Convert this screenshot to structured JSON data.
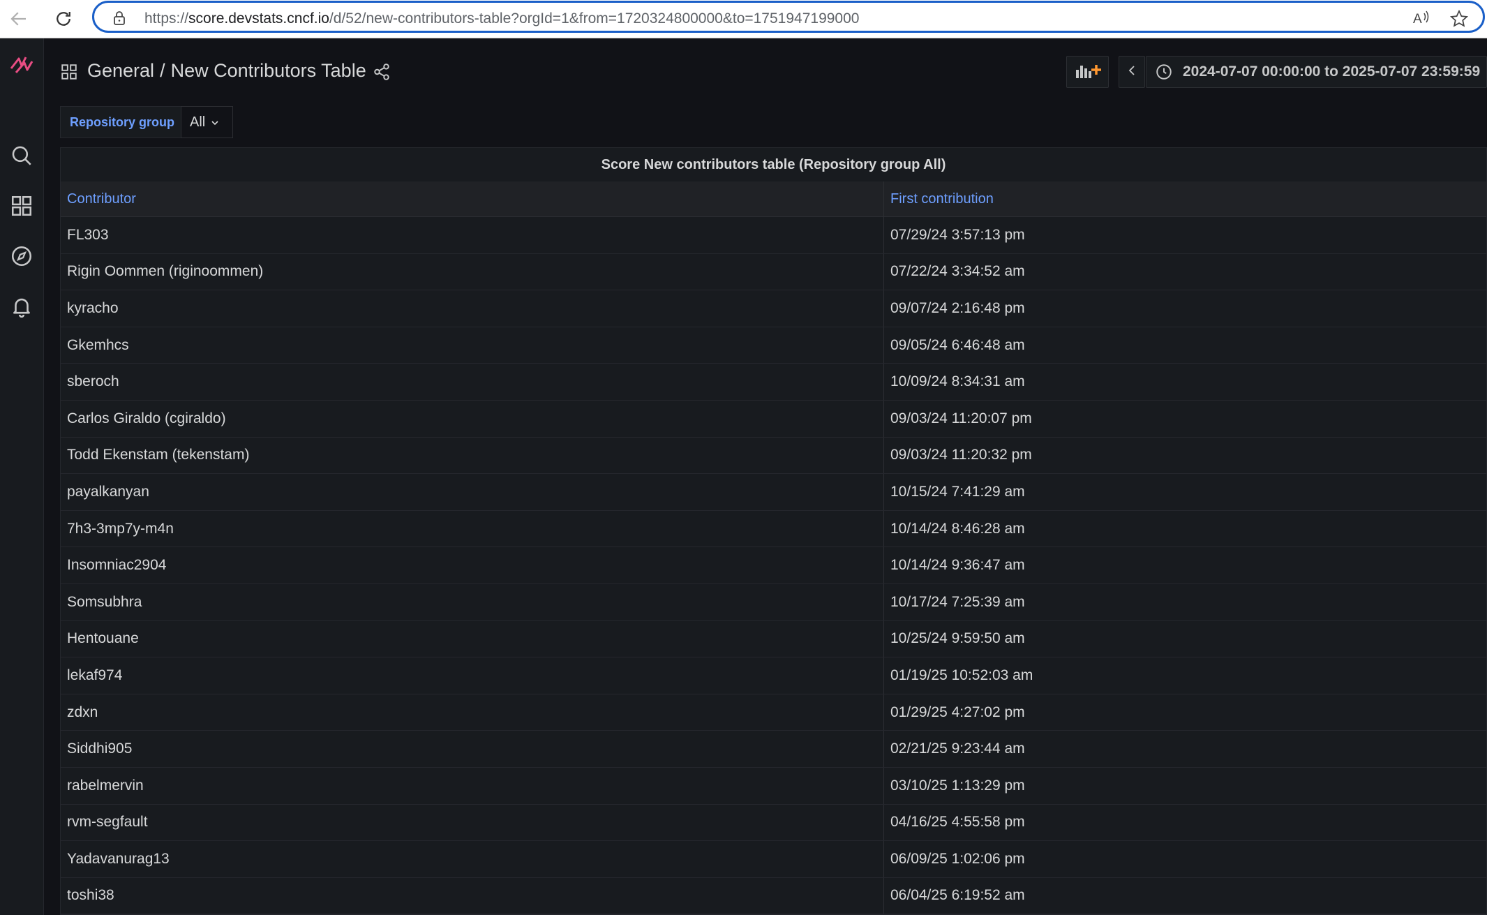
{
  "browser": {
    "url_prefix": "https://",
    "url_host": "score.devstats.cncf.io",
    "url_path": "/d/52/new-contributors-table?orgId=1&from=1720324800000&to=1751947199000"
  },
  "icons": {
    "back": "back-arrow-icon",
    "reload": "reload-icon",
    "lock": "lock-icon",
    "read_aloud": "read-aloud-icon",
    "favorite": "star-icon",
    "logo": "grafana-logo-icon",
    "search": "search-icon",
    "dashboards": "dashboards-icon",
    "explore": "compass-icon",
    "alerting": "bell-icon",
    "share": "share-icon",
    "add_panel": "add-panel-icon",
    "time_back": "chevron-left-icon",
    "clock": "clock-icon"
  },
  "colors": {
    "accent": "#6e9fff",
    "brand": "#e84d83",
    "background": "#111217",
    "panel": "#181b1f"
  },
  "header": {
    "folder": "General",
    "separator": "/",
    "title": "New Contributors Table",
    "time_range": "2024-07-07 00:00:00 to 2025-07-07 23:59:59"
  },
  "variables": {
    "label": "Repository group",
    "value": "All"
  },
  "panel": {
    "title": "Score New contributors table (Repository group All)",
    "columns": [
      "Contributor",
      "First contribution"
    ],
    "rows": [
      [
        "FL303",
        "07/29/24 3:57:13 pm"
      ],
      [
        "Rigin Oommen (riginoommen)",
        "07/22/24 3:34:52 am"
      ],
      [
        "kyracho",
        "09/07/24 2:16:48 pm"
      ],
      [
        "Gkemhcs",
        "09/05/24 6:46:48 am"
      ],
      [
        "sberoch",
        "10/09/24 8:34:31 am"
      ],
      [
        "Carlos Giraldo (cgiraldo)",
        "09/03/24 11:20:07 pm"
      ],
      [
        "Todd Ekenstam (tekenstam)",
        "09/03/24 11:20:32 pm"
      ],
      [
        "payalkanyan",
        "10/15/24 7:41:29 am"
      ],
      [
        "7h3-3mp7y-m4n",
        "10/14/24 8:46:28 am"
      ],
      [
        "Insomniac2904",
        "10/14/24 9:36:47 am"
      ],
      [
        "Somsubhra",
        "10/17/24 7:25:39 am"
      ],
      [
        "Hentouane",
        "10/25/24 9:59:50 am"
      ],
      [
        "lekaf974",
        "01/19/25 10:52:03 am"
      ],
      [
        "zdxn",
        "01/29/25 4:27:02 pm"
      ],
      [
        "Siddhi905",
        "02/21/25 9:23:44 am"
      ],
      [
        "rabelmervin",
        "03/10/25 1:13:29 pm"
      ],
      [
        "rvm-segfault",
        "04/16/25 4:55:58 pm"
      ],
      [
        "Yadavanurag13",
        "06/09/25 1:02:06 pm"
      ],
      [
        "toshi38",
        "06/04/25 6:19:52 am"
      ]
    ]
  }
}
